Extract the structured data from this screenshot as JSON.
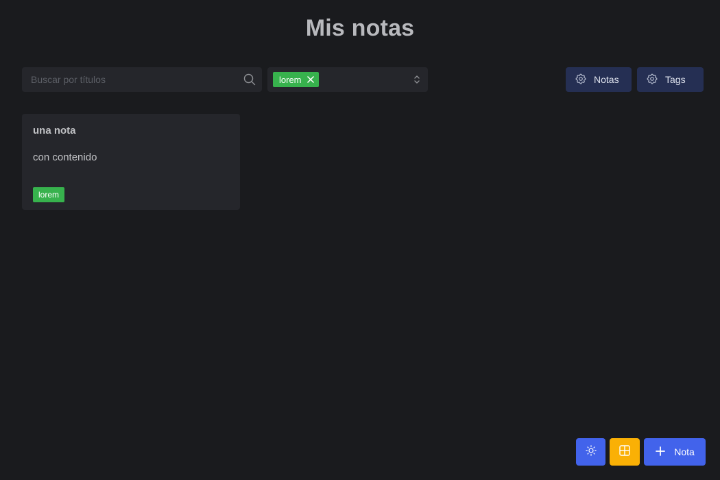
{
  "header": {
    "title": "Mis notas"
  },
  "search": {
    "placeholder": "Buscar por títulos",
    "value": ""
  },
  "tag_filter": {
    "selected": [
      {
        "label": "lorem"
      }
    ]
  },
  "toolbar": {
    "notes_label": "Notas",
    "tags_label": "Tags"
  },
  "notes": [
    {
      "title": "una nota",
      "body": "con contenido",
      "tags": [
        "lorem"
      ]
    }
  ],
  "actions": {
    "new_note_label": "Nota"
  },
  "colors": {
    "background": "#1a1b1e",
    "surface": "#25262b",
    "tag": "#37b24d",
    "primary": "#4263eb",
    "accent": "#fab005",
    "toolbar_button": "#252f53"
  },
  "icons": {
    "search": "search-icon",
    "remove": "close-icon",
    "select": "chevron-up-down-icon",
    "settings": "gear-icon",
    "theme": "sun-icon",
    "layout": "grid-icon",
    "add": "plus-icon"
  }
}
